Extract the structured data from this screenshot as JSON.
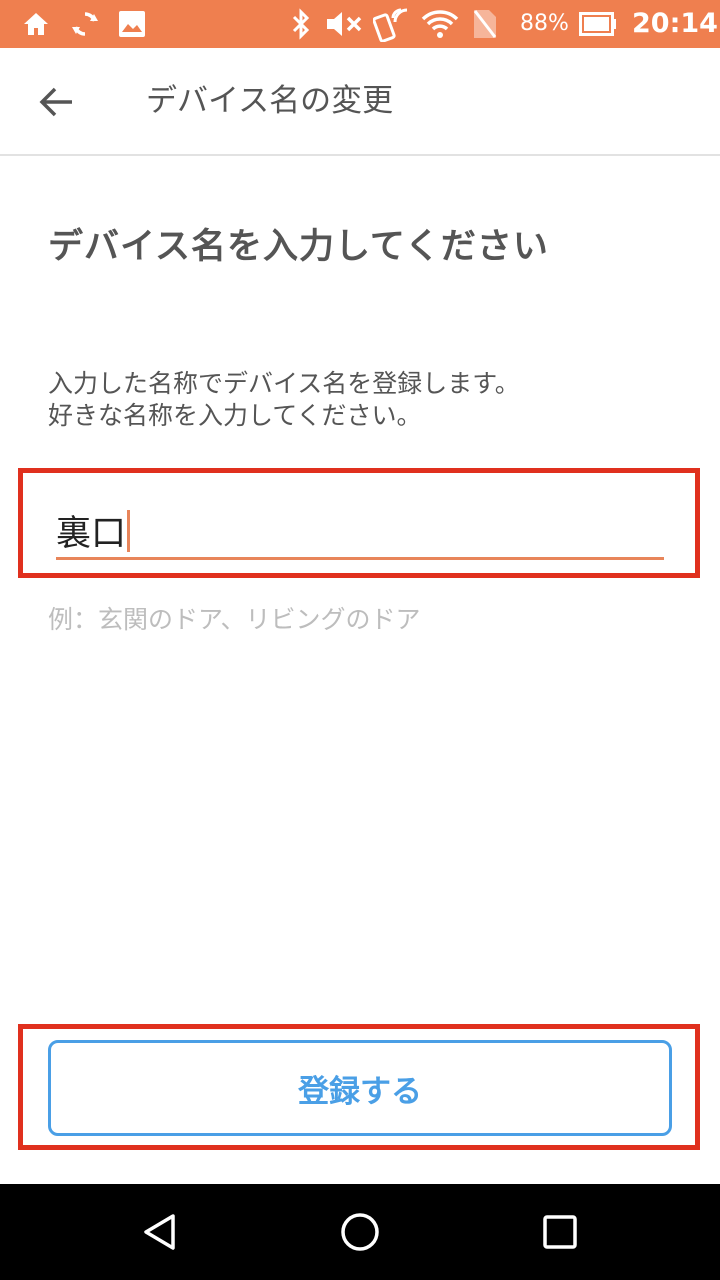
{
  "status_bar": {
    "battery_percent": "88%",
    "time": "20:14",
    "icons": [
      "home-icon",
      "sync-icon",
      "image-icon",
      "bluetooth-icon",
      "mute-icon",
      "nfc-icon",
      "wifi-icon",
      "no-sim-icon",
      "battery-icon"
    ]
  },
  "app_bar": {
    "title": "デバイス名の変更",
    "back_icon": "arrow-back-icon"
  },
  "main": {
    "heading": "デバイス名を入力してください",
    "description_line1": "入力した名称でデバイス名を登録します。",
    "description_line2": "好きな名称を入力してください。",
    "device_name_value": "裏口",
    "hint": "例：玄関のドア、リビングのドア",
    "register_label": "登録する"
  },
  "colors": {
    "status_bar": "#ef7f4f",
    "accent": "#e8855a",
    "button": "#4a9fe6",
    "highlight": "#e0301e"
  },
  "nav_bar": {
    "icons": [
      "nav-back-icon",
      "nav-home-icon",
      "nav-recents-icon"
    ]
  }
}
